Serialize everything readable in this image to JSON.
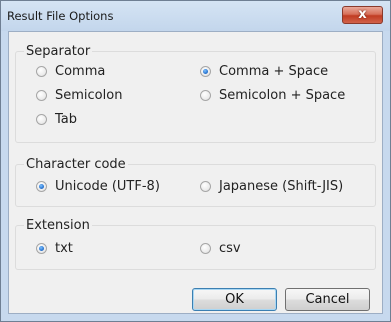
{
  "window": {
    "title": "Result File Options",
    "close_glyph": "x"
  },
  "separator": {
    "legend": "Separator",
    "options": [
      {
        "label": "Comma",
        "checked": false
      },
      {
        "label": "Comma + Space",
        "checked": true
      },
      {
        "label": "Semicolon",
        "checked": false
      },
      {
        "label": "Semicolon + Space",
        "checked": false
      },
      {
        "label": "Tab",
        "checked": false
      }
    ]
  },
  "character_code": {
    "legend": "Character code",
    "options": [
      {
        "label": "Unicode (UTF-8)",
        "checked": true
      },
      {
        "label": "Japanese (Shift-JIS)",
        "checked": false
      }
    ]
  },
  "extension": {
    "legend": "Extension",
    "options": [
      {
        "label": "txt",
        "checked": true
      },
      {
        "label": "csv",
        "checked": false
      }
    ]
  },
  "buttons": {
    "ok_label": "OK",
    "cancel_label": "Cancel"
  }
}
